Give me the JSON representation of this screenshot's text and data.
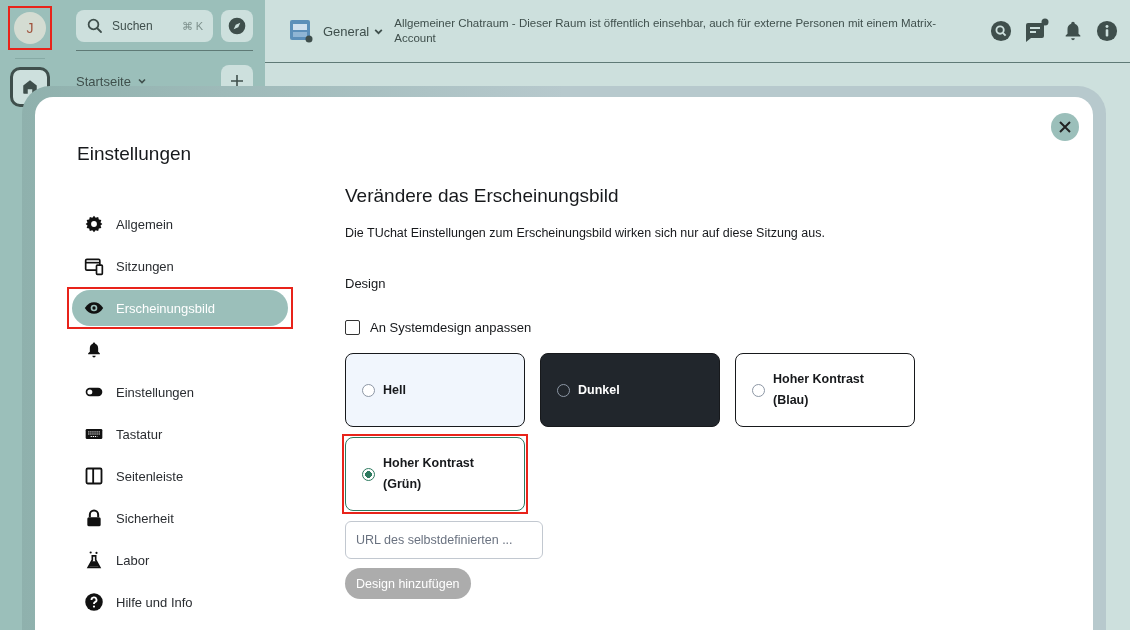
{
  "rail": {
    "avatar": {
      "initial": "J",
      "highlighted": true
    }
  },
  "spaces": {
    "search": {
      "label": "Suchen",
      "shortcut": "⌘ K"
    },
    "home": {
      "label": "Startseite"
    }
  },
  "room_header": {
    "name": "General",
    "topic": "Allgemeiner Chatraum - Dieser Raum ist öffentlich einsehbar, auch für externe Personen mit einem Matrix-Account",
    "threads_unread": true
  },
  "dialog": {
    "title": "Einstellungen",
    "nav": [
      {
        "kind": "gear",
        "label": "Allgemein",
        "selected": false,
        "highlighted": false
      },
      {
        "kind": "devices",
        "label": "Sitzungen",
        "selected": false,
        "highlighted": false
      },
      {
        "kind": "eye",
        "label": "Erscheinungsbild",
        "selected": true,
        "highlighted": true
      },
      {
        "kind": "bell",
        "selected": false,
        "highlighted": false
      },
      {
        "kind": "toggle",
        "label": "Einstellungen",
        "selected": false,
        "highlighted": false
      },
      {
        "kind": "keyboard",
        "label": "Tastatur",
        "selected": false,
        "highlighted": false
      },
      {
        "kind": "sidebar",
        "label": "Seitenleiste",
        "selected": false,
        "highlighted": false
      },
      {
        "kind": "lock",
        "label": "Sicherheit",
        "selected": false,
        "highlighted": false
      },
      {
        "kind": "flask",
        "label": "Labor",
        "selected": false,
        "highlighted": false
      },
      {
        "kind": "help",
        "label": "Hilfe und Info",
        "selected": false,
        "highlighted": false
      }
    ],
    "heading": "Verändere das Erscheinungsbild",
    "description": "Die TUchat Einstellungen zum Erscheinungsbild wirken sich nur auf diese Sitzung aus.",
    "section": "Design",
    "system_theme": {
      "label": "An Systemdesign anpassen",
      "checked": false
    },
    "themes": [
      {
        "label": "Hell",
        "kind": "light",
        "selected": false,
        "highlighted": false
      },
      {
        "label": "Dunkel",
        "kind": "dark",
        "selected": false,
        "highlighted": false
      },
      {
        "label": "Hoher Kontrast (Blau)",
        "kind": "contrast",
        "selected": false,
        "highlighted": false
      },
      {
        "label": "Hoher Kontrast (Grün)",
        "kind": "contrast",
        "selected": true,
        "highlighted": true
      }
    ],
    "custom_theme": {
      "placeholder": "URL des selbstdefinierten ...",
      "button": "Design hinzufügen",
      "disabled": true
    }
  }
}
